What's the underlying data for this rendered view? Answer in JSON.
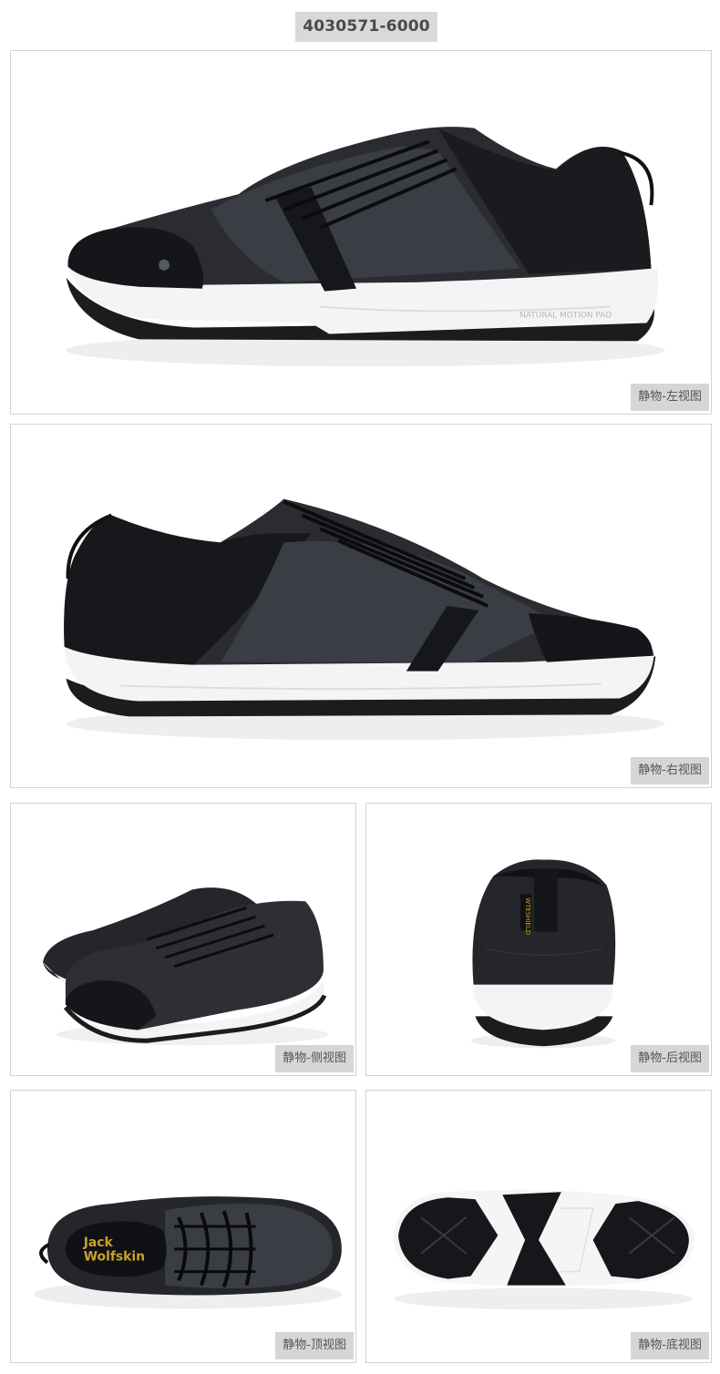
{
  "sku": "4030571-6000",
  "colors": {
    "upper": "#2a2c31",
    "upper_dark": "#15161a",
    "mesh": "#3a3d44",
    "sole": "#f4f4f4",
    "outsole": "#1c1c1e",
    "label_bg": "#d6d6d6",
    "logo_gold": "#c9a227"
  },
  "views": [
    {
      "label": "静物-左视图"
    },
    {
      "label": "静物-右视图"
    },
    {
      "label": "静物-侧视图"
    },
    {
      "label": "静物-后视图"
    },
    {
      "label": "静物-顶视图"
    },
    {
      "label": "静物-底视图"
    }
  ],
  "shoe_texts": {
    "midsole": "NATURAL MOTION PAD",
    "heel_tab": "WTESHIELD",
    "brand_line1": "Jack",
    "brand_line2": "Wolfskin"
  }
}
